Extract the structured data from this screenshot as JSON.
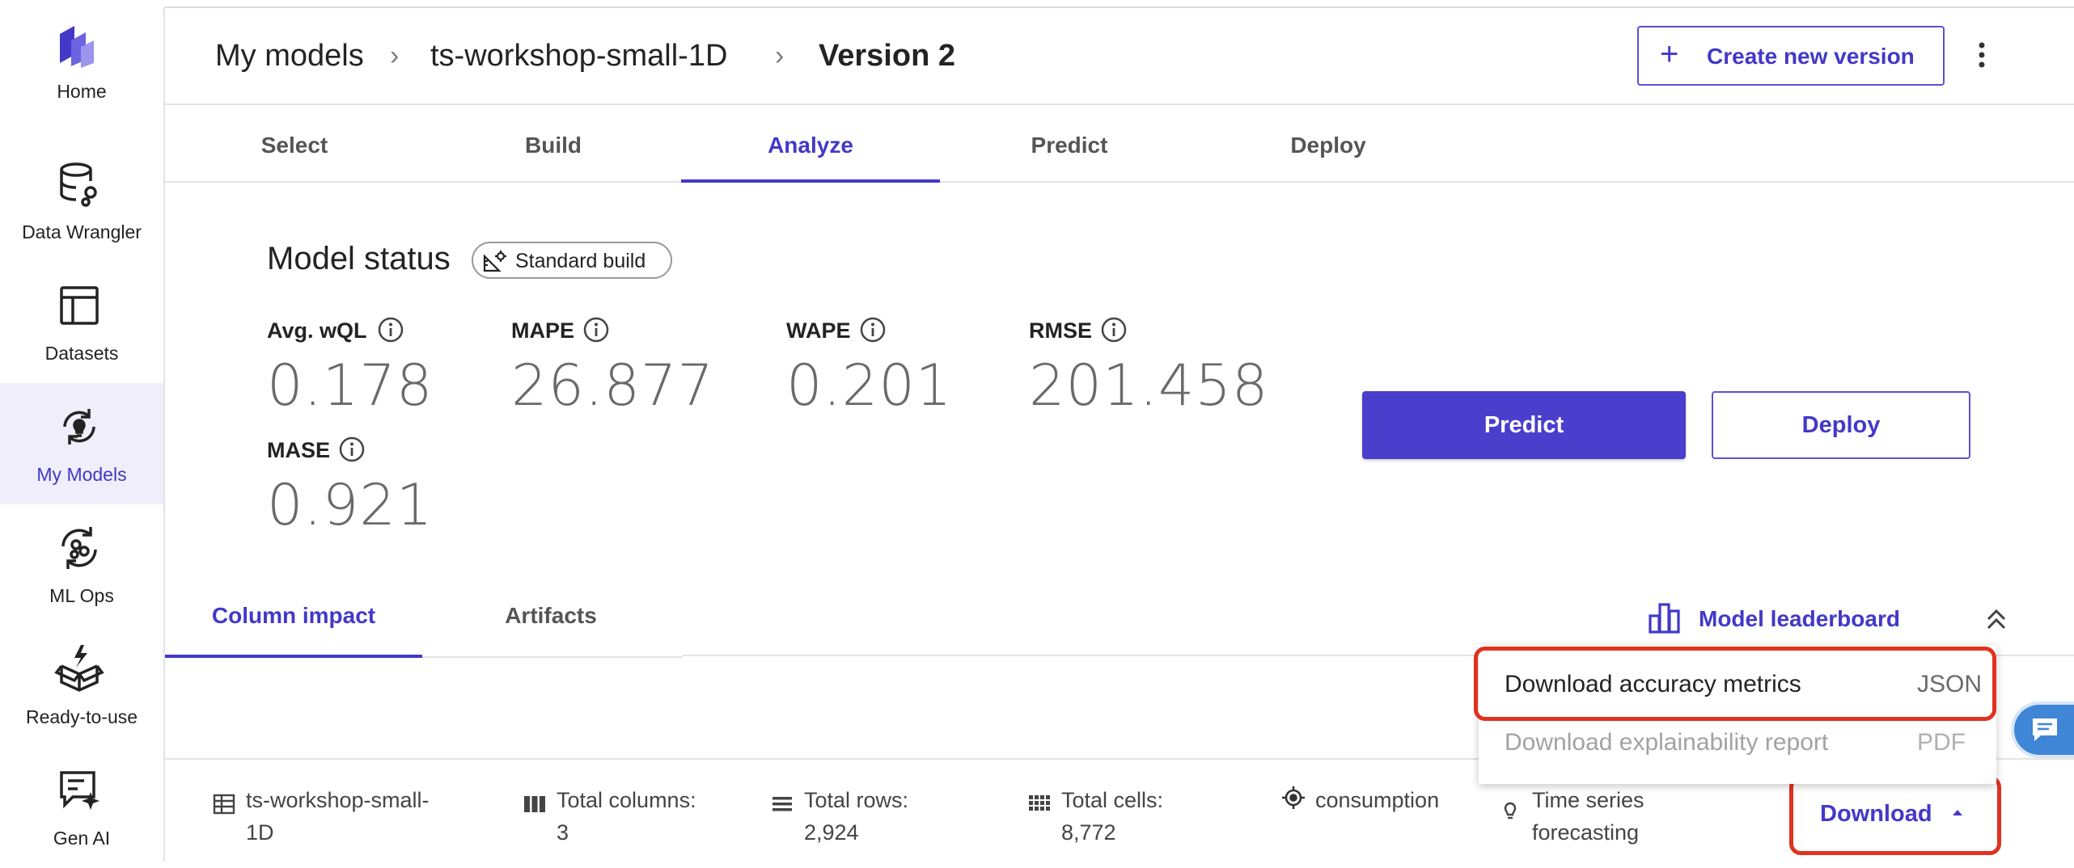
{
  "sidebar": {
    "items": [
      {
        "label": "Home",
        "icon": "home-logo-icon"
      },
      {
        "label": "Data Wrangler",
        "icon": "database-icon"
      },
      {
        "label": "Datasets",
        "icon": "table-icon"
      },
      {
        "label": "My Models",
        "icon": "lightbulb-refresh-icon",
        "active": true
      },
      {
        "label": "ML Ops",
        "icon": "ml-ops-cycle-icon"
      },
      {
        "label": "Ready-to-use",
        "icon": "box-bolt-icon"
      },
      {
        "label": "Gen AI",
        "icon": "chat-sparkle-icon"
      }
    ]
  },
  "breadcrumb": {
    "root": "My models",
    "model": "ts-workshop-small-1D",
    "version": "Version 2"
  },
  "header": {
    "create_label": "Create new version"
  },
  "steps": [
    "Select",
    "Build",
    "Analyze",
    "Predict",
    "Deploy"
  ],
  "active_step": "Analyze",
  "model_status": {
    "title": "Model status",
    "build_type": "Standard build",
    "metrics": [
      {
        "label": "Avg. wQL",
        "value": "0.178"
      },
      {
        "label": "MAPE",
        "value": "26.877"
      },
      {
        "label": "WAPE",
        "value": "0.201"
      },
      {
        "label": "RMSE",
        "value": "201.458"
      },
      {
        "label": "MASE",
        "value": "0.921"
      }
    ]
  },
  "actions": {
    "predict_label": "Predict",
    "deploy_label": "Deploy"
  },
  "subtabs": [
    "Column impact",
    "Artifacts"
  ],
  "leaderboard_label": "Model leaderboard",
  "download_menu": {
    "items": [
      {
        "label": "Download accuracy metrics",
        "format": "JSON",
        "enabled": true
      },
      {
        "label": "Download explainability report",
        "format": "PDF",
        "enabled": false
      }
    ]
  },
  "footer": {
    "dataset": "ts-workshop-small-\n1D",
    "total_columns": "Total columns:\n3",
    "total_rows": "Total rows:\n2,924",
    "total_cells": "Total cells:\n8,772",
    "target": "consumption",
    "problem_type": "Time series\nforecasting",
    "download_label": "Download"
  },
  "colors": {
    "accent": "#4338c8",
    "primary_button": "#4a3fcc",
    "highlight": "#e0321f",
    "active_nav_bg": "#efeefa",
    "chat_button": "#3f86d6"
  }
}
